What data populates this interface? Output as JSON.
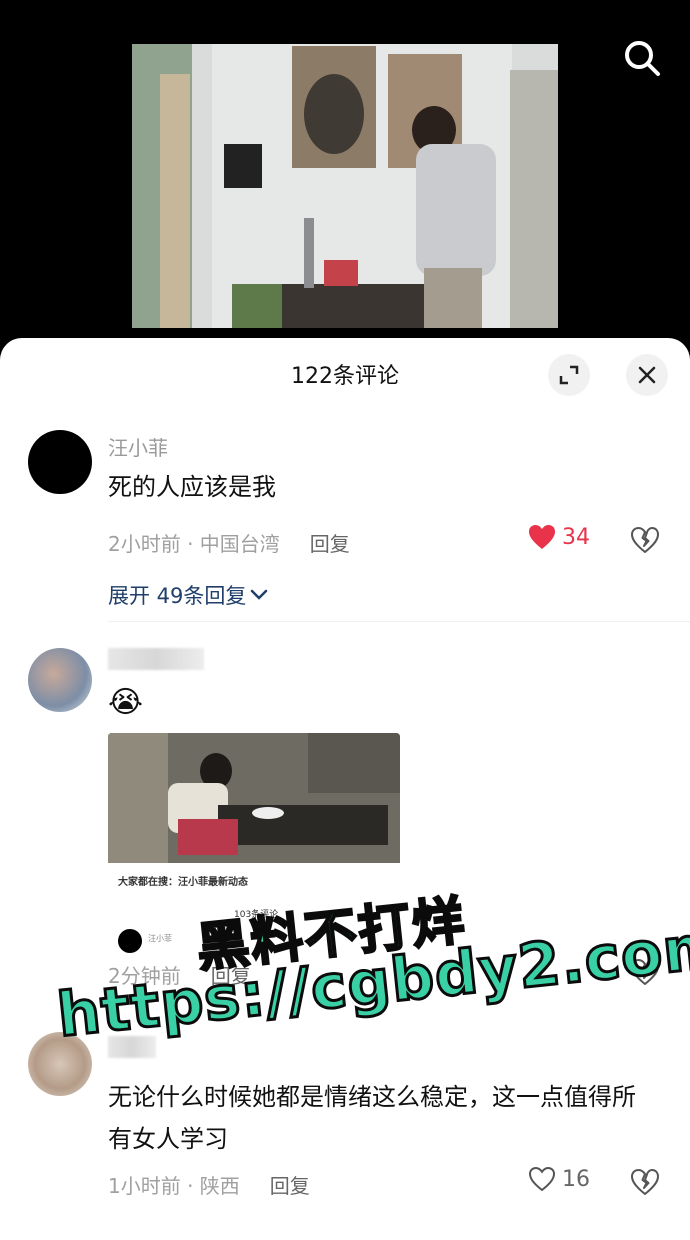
{
  "sheet": {
    "title": "122条评论"
  },
  "comments": [
    {
      "name": "汪小菲",
      "text": "死的人应该是我",
      "time_location": "2小时前 · 中国台湾",
      "reply_label": "回复",
      "likes": "34",
      "liked": true,
      "expand_label": "展开 49条回复"
    },
    {
      "emoji": "😭",
      "time_location": "2分钟前",
      "reply_label": "回复",
      "attachment": {
        "search_text": "大家都在搜：汪小菲最新动态",
        "comment_count": "103条评论",
        "user": "汪小菲"
      }
    },
    {
      "text": "无论什么时候她都是情绪这么稳定，这一点值得所有女人学习",
      "time_location": "1小时前 · 陕西",
      "reply_label": "回复",
      "likes": "16",
      "liked": false
    }
  ],
  "watermark": {
    "line1": "黑料不打烊",
    "line2": "https://cgbdy2.com"
  },
  "colors": {
    "like_active": "#e8334a",
    "link": "#1f3e69",
    "watermark": "#3ad0a6"
  }
}
